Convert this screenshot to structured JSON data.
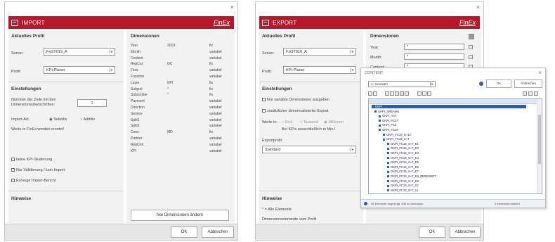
{
  "import": {
    "title": "IMPORT",
    "brand": "FinEx",
    "close": "×",
    "aktuelles_profil": "Aktuelles Profil",
    "server_label": "Server:",
    "server_value": "FxGT019_A",
    "profil_label": "Profil:",
    "profil_value": "KPI-Planer",
    "einstellungen": "Einstellungen",
    "nummer_label": "Nummer der Zeile mit den Dimensionsüberschriften:",
    "nummer_value": "1",
    "import_art_label": "Import-Art:",
    "selektiv": "Selektiv",
    "additiv": "Additiv",
    "ersetzt_text": "Werte in FinEx werden ersetzt!",
    "cb_kpi": "keine KPI-Skalierung",
    "cb_validierung": "Nur Validierung / kein Import",
    "cb_bericht": "Erzeuge Import-Bericht",
    "hinweise": "Hinweise",
    "dimensionen": "Dimensionen",
    "dims": [
      {
        "name": "Year",
        "value": "2019",
        "mode": "fix"
      },
      {
        "name": "Month",
        "value": "",
        "mode": "variabel"
      },
      {
        "name": "Content",
        "value": "",
        "mode": "variabel"
      },
      {
        "name": "RepCur",
        "value": "GC",
        "mode": "fix"
      },
      {
        "name": "Flow",
        "value": "",
        "mode": "variabel"
      },
      {
        "name": "Function",
        "value": "",
        "mode": "variabel"
      },
      {
        "name": "Layer",
        "value": "KPI",
        "mode": "fix"
      },
      {
        "name": "Subject",
        "value": "*",
        "mode": "fix"
      },
      {
        "name": "Subscriber",
        "value": "*",
        "mode": "fix"
      },
      {
        "name": "Payment",
        "value": "",
        "mode": "variabel"
      },
      {
        "name": "Direction",
        "value": "",
        "mode": "variabel"
      },
      {
        "name": "Service",
        "value": "",
        "mode": "variabel"
      },
      {
        "name": "Split1",
        "value": "",
        "mode": "variabel"
      },
      {
        "name": "Split2",
        "value": "",
        "mode": "variabel"
      },
      {
        "name": "Cons",
        "value": "MD",
        "mode": "fix"
      },
      {
        "name": "Partner",
        "value": "",
        "mode": "variabel"
      },
      {
        "name": "RepUnit",
        "value": "",
        "mode": "variabel"
      },
      {
        "name": "KPI",
        "value": "",
        "mode": "variabel"
      }
    ],
    "fixe_btn": "fixe Dimensionen ändern",
    "ok": "OK",
    "abbrechen": "Abbrechen"
  },
  "export": {
    "title": "EXPORT",
    "brand": "FinEx",
    "close": "×",
    "aktuelles_profil": "Aktuelles Profil",
    "server_label": "Server:",
    "server_value": "FxGT019_A",
    "profil_label": "Profil:",
    "profil_value": "KPI-Planer",
    "einstellungen": "Einstellungen",
    "cb_variable": "Nur variable Dimensionen ausgeben",
    "cb_denorm": "zusätzlicher denormalisierter Export",
    "werte_in": "Werte in:",
    "eins": "Eins",
    "tausend": "Tausend",
    "millionen": "Millionen",
    "kpi_note": "Bei KPIs ausschließlich in Mio.!",
    "exportprofil": "Exportprofil:",
    "exportprofil_value": "Standard",
    "hinweise": "Hinweise",
    "hinweis1": "* = Alle Elemente",
    "hinweis2": "Dimensionselemente vom Profil",
    "dimensionen": "Dimensionen",
    "year_label": "Year:",
    "month_label": "Month:",
    "content_label": "Content:",
    "year_value": "*",
    "month_value": "*",
    "content_value": "*",
    "ok": "OK",
    "abbrechen": "Abbrechen"
  },
  "content_popup": {
    "title": "CONTENT",
    "close": "×",
    "filter_value": "A: Grenwen",
    "ok": "OK",
    "abbrechen": "Abbrechen",
    "tree": [
      "GKPI",
      "GKPI_DREAMS",
      "GKPI_ACT",
      "GKPI_FCST",
      "GKPI_FC0",
      "GKPI_FC19",
      "GKPI_FC19_S+12",
      "GKPI_FC19_S+7",
      "GKPI_FC19_S+7_E1",
      "GKPI_FC19_S+7_E2",
      "GKPI_FC19_S+7_E3",
      "GKPI_FC19_S+7_E4",
      "GKPI_FC19_S+7_E5",
      "GKPI_FC19_S+7_E6",
      "GKPI_FC19_S+7_E7",
      "GKPI_FC19_S+7_E8_BEREINIGT",
      "GKPI_FC19_S+7_E9",
      "GKPI_FC19_S+7_10",
      "GKPI_FC19_S+7_11"
    ],
    "status_left": "26 Elemente angezeigt, 108 in Dimension",
    "status_right": "3 Elemente markiert"
  }
}
